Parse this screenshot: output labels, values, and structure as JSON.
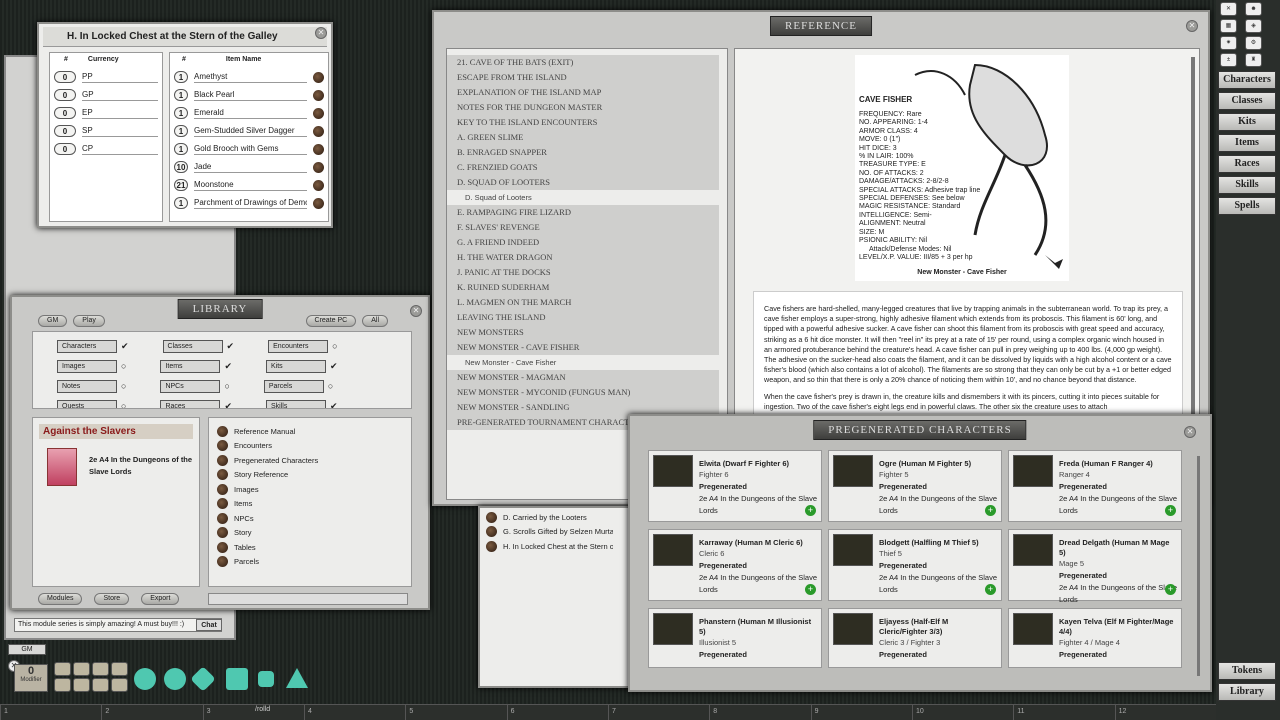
{
  "chest": {
    "title": "H. In Locked Chest at the Stern of the Galley",
    "hash1": "#",
    "currency_header": "Currency",
    "hash2": "#",
    "item_header": "Item Name",
    "currency": [
      {
        "n": "0",
        "c": "PP"
      },
      {
        "n": "0",
        "c": "GP"
      },
      {
        "n": "0",
        "c": "EP"
      },
      {
        "n": "0",
        "c": "SP"
      },
      {
        "n": "0",
        "c": "CP"
      }
    ],
    "items": [
      {
        "n": "1",
        "name": "Amethyst"
      },
      {
        "n": "1",
        "name": "Black Pearl"
      },
      {
        "n": "1",
        "name": "Emerald"
      },
      {
        "n": "1",
        "name": "Gem-Studded Silver Dagger"
      },
      {
        "n": "1",
        "name": "Gold Brooch with Gems"
      },
      {
        "n": "10",
        "name": "Jade"
      },
      {
        "n": "21",
        "name": "Moonstone"
      },
      {
        "n": "1",
        "name": "Parchment of Drawings of Demons"
      }
    ]
  },
  "library": {
    "title": "LIBRARY",
    "tabs": [
      "GM",
      "Play"
    ],
    "create_pc": "Create PC",
    "all": "All",
    "filters": [
      [
        "Characters",
        "Classes",
        "Encounters"
      ],
      [
        "Images",
        "Items",
        "Kits"
      ],
      [
        "Notes",
        "NPCs",
        "Parcels"
      ],
      [
        "Quests",
        "Races",
        "Skills"
      ]
    ],
    "module_title": "Against the Slavers",
    "module_name": "2e A4 In the Dungeons of the Slave Lords",
    "entries": [
      "Reference Manual",
      "Encounters",
      "Pregenerated Characters",
      "Story Reference",
      "Images",
      "Items",
      "NPCs",
      "Story",
      "Tables",
      "Parcels"
    ],
    "bottom_buttons": [
      "Modules",
      "Store",
      "Export"
    ]
  },
  "chat": {
    "message": "This module series is simply amazing! A must buy!!! :)",
    "send": "Chat",
    "gm_label": "GM",
    "modifier": "0",
    "modifier_label": "Modifier"
  },
  "reference": {
    "title": "REFERENCE",
    "toc": [
      {
        "t": "21. CAVE OF THE BATS (EXIT)",
        "sub": false
      },
      {
        "t": "ESCAPE FROM THE ISLAND",
        "sub": false
      },
      {
        "t": "EXPLANATION OF THE ISLAND MAP",
        "sub": false
      },
      {
        "t": "NOTES FOR THE DUNGEON MASTER",
        "sub": false
      },
      {
        "t": "KEY TO THE ISLAND ENCOUNTERS",
        "sub": false
      },
      {
        "t": "A. GREEN SLIME",
        "sub": false
      },
      {
        "t": "B. ENRAGED SNAPPER",
        "sub": false
      },
      {
        "t": "C. FRENZIED GOATS",
        "sub": false
      },
      {
        "t": "D. SQUAD OF LOOTERS",
        "sub": false
      },
      {
        "t": "D. Squad of Looters",
        "sub": true
      },
      {
        "t": "E. RAMPAGING FIRE LIZARD",
        "sub": false
      },
      {
        "t": "F. SLAVES' REVENGE",
        "sub": false
      },
      {
        "t": "G. A FRIEND INDEED",
        "sub": false
      },
      {
        "t": "H. THE WATER DRAGON",
        "sub": false
      },
      {
        "t": "J. PANIC AT THE DOCKS",
        "sub": false
      },
      {
        "t": "K. RUINED SUDERHAM",
        "sub": false
      },
      {
        "t": "L. MAGMEN ON THE MARCH",
        "sub": false
      },
      {
        "t": "LEAVING THE ISLAND",
        "sub": false
      },
      {
        "t": "NEW MONSTERS",
        "sub": false
      },
      {
        "t": "NEW MONSTER - CAVE FISHER",
        "sub": false
      },
      {
        "t": "New Monster - Cave Fisher",
        "sub": true
      },
      {
        "t": "NEW MONSTER - MAGMAN",
        "sub": false
      },
      {
        "t": "NEW MONSTER - MYCONID (FUNGUS MAN)",
        "sub": false
      },
      {
        "t": "NEW MONSTER - SANDLING",
        "sub": false
      },
      {
        "t": "PRE-GENERATED TOURNAMENT CHARACTERS",
        "sub": false
      }
    ],
    "monster_name": "CAVE FISHER",
    "stats": [
      "FREQUENCY: Rare",
      "NO. APPEARING: 1-4",
      "ARMOR CLASS: 4",
      "MOVE: 0 (1\")",
      "HIT DICE: 3",
      "% IN LAIR: 100%",
      "TREASURE TYPE: E",
      "NO. OF ATTACKS: 2",
      "DAMAGE/ATTACKS: 2-8/2-8",
      "SPECIAL ATTACKS: Adhesive trap line",
      "SPECIAL DEFENSES: See below",
      "MAGIC RESISTANCE: Standard",
      "INTELLIGENCE: Semi-",
      "ALIGNMENT: Neutral",
      "SIZE: M",
      "PSIONIC ABILITY: Nil",
      "Attack/Defense Modes: Nil",
      "LEVEL/X.P. VALUE: III/85 + 3 per hp"
    ],
    "caption": "New Monster - Cave Fisher",
    "para1": "Cave fishers are hard-shelled, many-legged creatures that live by trapping animals in the subterranean world. To trap its prey, a cave fisher employs a super-strong, highly adhesive filament which extends from its proboscis. This filament is 60' long, and tipped with a powerful adhesive sucker. A cave fisher can shoot this filament from its proboscis with great speed and accuracy, striking as a 6 hit dice monster. It will then \"reel in\" its prey at a rate of 15' per round, using a complex organic winch housed in an armored protuberance behind the creature's head. A cave fisher can pull in prey weighing up to 400 lbs. (4,000 gp weight). The adhesive on the sucker-head also coats the filament, and it can be dissolved by liquids with a high alcohol content or a cave fisher's blood (which also contains a lot of alcohol). The filaments are so strong that they can only be cut by a +1 or better edged weapon, and so thin that there is only a 20% chance of noticing them within 10', and no chance beyond that distance.",
    "para2": "When the cave fisher's prey is drawn in, the creature kills and dismembers it with its pincers, cutting it into pieces suitable for ingestion. Two of the cave fisher's eight legs end in powerful claws. The other six the creature uses to attach"
  },
  "parcels": [
    "D. Carried by the Looters",
    "G. Scrolls Gifted by Selzen Murtan",
    "H. In Locked Chest at the Stern of the Galley"
  ],
  "pregen": {
    "title": "PREGENERATED CHARACTERS",
    "cards": [
      {
        "name": "Elwita (Dwarf F Fighter 6)",
        "cls": "Fighter 6",
        "tag": "Pregenerated",
        "mod": "2e A4 In the Dungeons of the Slave Lords"
      },
      {
        "name": "Ogre (Human M Fighter 5)",
        "cls": "Fighter 5",
        "tag": "Pregenerated",
        "mod": "2e A4 In the Dungeons of the Slave Lords"
      },
      {
        "name": "Freda (Human F Ranger 4)",
        "cls": "Ranger 4",
        "tag": "Pregenerated",
        "mod": "2e A4 In the Dungeons of the Slave Lords"
      },
      {
        "name": "Karraway (Human M Cleric 6)",
        "cls": "Cleric 6",
        "tag": "Pregenerated",
        "mod": "2e A4 In the Dungeons of the Slave Lords"
      },
      {
        "name": "Blodgett (Halfling M Thief 5)",
        "cls": "Thief 5",
        "tag": "Pregenerated",
        "mod": "2e A4 In the Dungeons of the Slave Lords"
      },
      {
        "name": "Dread Delgath (Human M Mage 5)",
        "cls": "Mage 5",
        "tag": "Pregenerated",
        "mod": "2e A4 In the Dungeons of the Slave Lords"
      },
      {
        "name": "Phanstern (Human M Illusionist 5)",
        "cls": "Illusionist 5",
        "tag": "Pregenerated",
        "mod": ""
      },
      {
        "name": "Eljayess (Half-Elf M Cleric/Fighter 3/3)",
        "cls": "Cleric 3 / Fighter 3",
        "tag": "Pregenerated",
        "mod": ""
      },
      {
        "name": "Kayen Telva (Elf M Fighter/Mage 4/4)",
        "cls": "Fighter 4 / Mage 4",
        "tag": "Pregenerated",
        "mod": ""
      }
    ]
  },
  "sidebar": {
    "buttons": [
      "Characters",
      "Classes",
      "Kits",
      "Items",
      "Races",
      "Skills",
      "Spells"
    ],
    "bottom": [
      "Tokens",
      "Library"
    ]
  },
  "bottombar": {
    "numbers": [
      "1",
      "2",
      "3",
      "4",
      "5",
      "6",
      "7",
      "8",
      "9",
      "10",
      "11",
      "12"
    ],
    "roll": "/rolld"
  }
}
